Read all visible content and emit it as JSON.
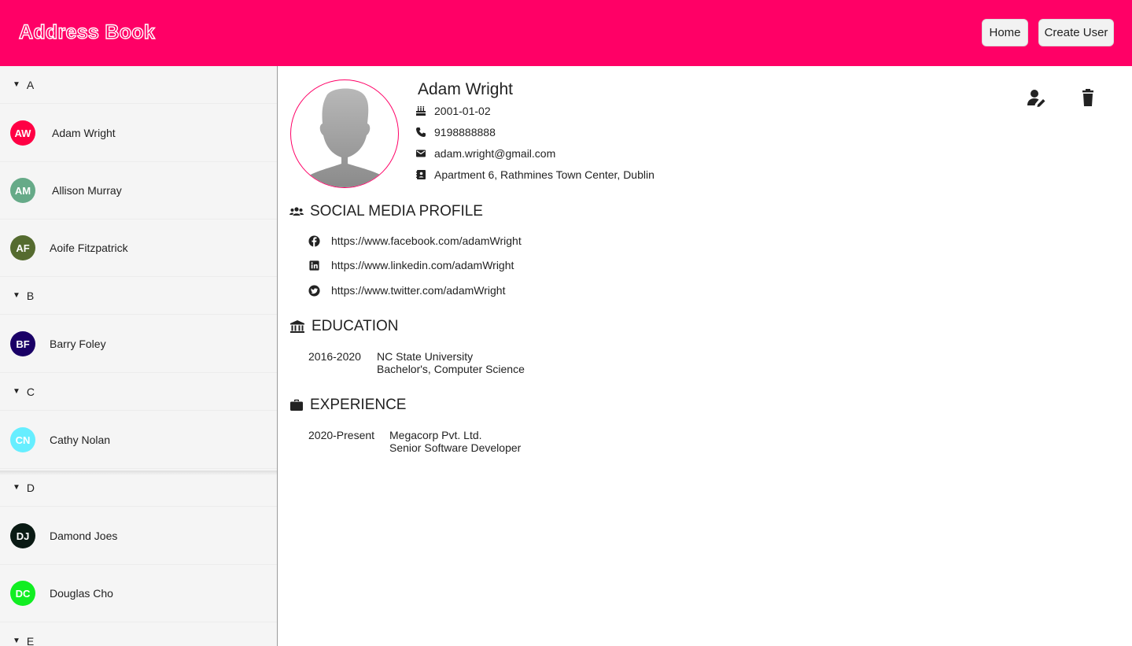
{
  "header": {
    "app_title": "Address Book",
    "home_label": "Home",
    "create_user_label": "Create User",
    "brand_color": "#ff0066"
  },
  "sidebar": {
    "groups": [
      {
        "letter": "A",
        "contacts": [
          {
            "initials": "AW",
            "name": "Adam Wright",
            "color": "#ff0044"
          },
          {
            "initials": "AM",
            "name": "Allison Murray",
            "color": "#66aa88"
          },
          {
            "initials": "AF",
            "name": "Aoife Fitzpatrick",
            "color": "#556b2f"
          }
        ]
      },
      {
        "letter": "B",
        "contacts": [
          {
            "initials": "BF",
            "name": "Barry Foley",
            "color": "#1a0066"
          }
        ]
      },
      {
        "letter": "C",
        "contacts": [
          {
            "initials": "CN",
            "name": "Cathy Nolan",
            "color": "#66eeff"
          }
        ]
      },
      {
        "letter": "D",
        "contacts": [
          {
            "initials": "DJ",
            "name": "Damond Joes",
            "color": "#0a1a14"
          },
          {
            "initials": "DC",
            "name": "Douglas Cho",
            "color": "#11ee22"
          }
        ]
      },
      {
        "letter": "E",
        "contacts": []
      }
    ]
  },
  "profile": {
    "name": "Adam Wright",
    "birthday": "2001-01-02",
    "phone": "9198888888",
    "email": "adam.wright@gmail.com",
    "address": "Apartment 6, Rathmines Town Center, Dublin"
  },
  "social": {
    "title": "SOCIAL MEDIA PROFILE",
    "facebook": "https://www.facebook.com/adamWright",
    "linkedin": "https://www.linkedin.com/adamWright",
    "twitter": "https://www.twitter.com/adamWright"
  },
  "education": {
    "title": "EDUCATION",
    "items": [
      {
        "period": "2016-2020",
        "institution": "NC State University",
        "degree": "Bachelor's, Computer Science"
      }
    ]
  },
  "experience": {
    "title": "EXPERIENCE",
    "items": [
      {
        "period": "2020-Present",
        "company": "Megacorp Pvt. Ltd.",
        "role": "Senior Software Developer"
      }
    ]
  },
  "icons": {
    "edit": "edit-user-icon",
    "delete": "trash-icon",
    "birthday": "cake-icon",
    "phone": "phone-icon",
    "email": "envelope-icon",
    "address": "contact-book-icon",
    "social": "users-icon",
    "education": "institution-icon",
    "experience": "briefcase-icon"
  }
}
